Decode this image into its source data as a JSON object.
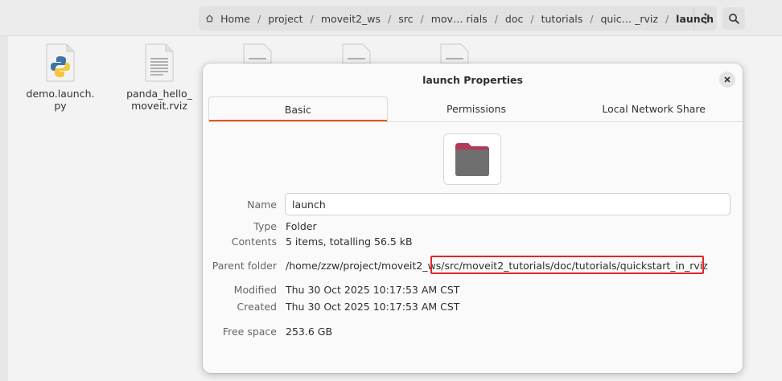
{
  "pathbar": {
    "crumbs": [
      "Home",
      "project",
      "moveit2_ws",
      "src",
      "mov… rials",
      "doc",
      "tutorials",
      "quic… _rviz",
      "launch"
    ],
    "menu_icon": "vertical-ellipsis-icon",
    "search_icon": "search-icon"
  },
  "files": [
    {
      "name": "demo.launch.py",
      "line1": "demo.launch.",
      "line2": "py",
      "icon": "python-file-icon"
    },
    {
      "name": "panda_hello_moveit.rviz",
      "line1": "panda_hello_",
      "line2": "moveit.rviz",
      "icon": "text-file-icon"
    }
  ],
  "dialog": {
    "title": "launch Properties",
    "tabs": [
      "Basic",
      "Permissions",
      "Local Network Share"
    ],
    "active_tab": "Basic",
    "fields": {
      "name_label": "Name",
      "name_value": "launch",
      "type_label": "Type",
      "type_value": "Folder",
      "contents_label": "Contents",
      "contents_value": "5 items, totalling 56.5 kB",
      "parent_label": "Parent folder",
      "parent_value": "/home/zzw/project/moveit2_ws/src/moveit2_tutorials/doc/tutorials/quickstart_in_rviz",
      "modified_label": "Modified",
      "modified_value": "Thu 30 Oct 2025 10:17:53 AM CST",
      "created_label": "Created",
      "created_value": "Thu 30 Oct 2025 10:17:53 AM CST",
      "free_label": "Free space",
      "free_value": "253.6 GB"
    }
  },
  "colors": {
    "accent": "#e95420",
    "highlight": "#e0262b",
    "folder_body": "#6e6e6e",
    "folder_tab": "#b03a58"
  }
}
